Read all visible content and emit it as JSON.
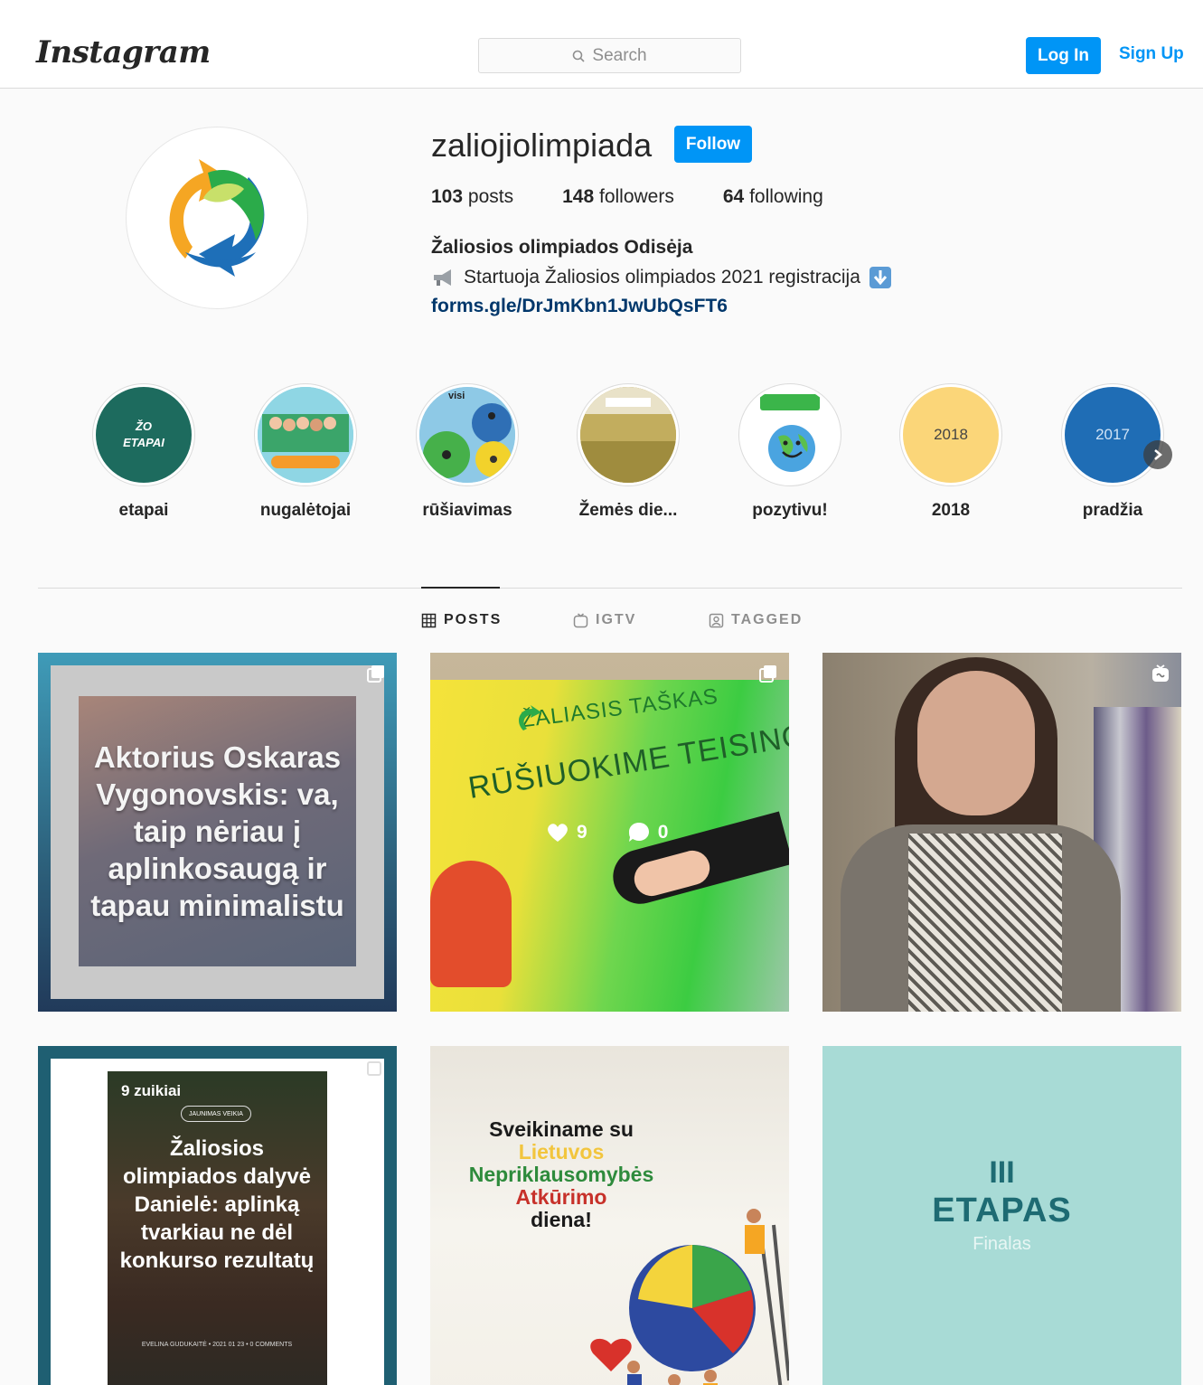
{
  "header": {
    "logo": "Instagram",
    "search_placeholder": "Search",
    "login_label": "Log In",
    "signup_label": "Sign Up"
  },
  "profile": {
    "username": "zaliojiolimpiada",
    "follow_label": "Follow",
    "posts_count": "103",
    "posts_label": "posts",
    "followers_count": "148",
    "followers_label": "followers",
    "following_count": "64",
    "following_label": "following",
    "full_name": "Žaliosios olimpiados Odisėja",
    "bio": "Startuoja Žaliosios olimpiados 2021 registracija",
    "link": "forms.gle/DrJmKbn1JwUbQsFT6"
  },
  "highlights": [
    {
      "label": "etapai",
      "cover_text": "ŽO ETAPAI"
    },
    {
      "label": "nugalėtojai"
    },
    {
      "label": "rūšiavimas",
      "cover_text": "visi"
    },
    {
      "label": "Žemės die..."
    },
    {
      "label": "pozytivu!"
    },
    {
      "label": "2018",
      "cover_text": "2018"
    },
    {
      "label": "pradžia",
      "cover_text": "2017"
    }
  ],
  "tabs": [
    {
      "label": "POSTS",
      "active": true
    },
    {
      "label": "IGTV",
      "active": false
    },
    {
      "label": "TAGGED",
      "active": false
    }
  ],
  "posts": [
    {
      "caption": "Aktorius Oskaras Vygonovskis: va, taip nėriau į aplinkosaugą ir tapau minimalistu"
    },
    {
      "title_top": "ŽALIASIS TAŠKAS",
      "title_main": "RŪŠIUOKIME TEISINGAI!",
      "likes": "9",
      "comments": "0"
    },
    {},
    {
      "header": "9 zuikiai",
      "tag": "JAUNIMAS VEIKIA",
      "caption": "Žaliosios olimpiados dalyvė Danielė: aplinką tvarkiau ne dėl konkurso rezultatų",
      "footer": "EVELINA GUDUKAITĖ • 2021 01 23 • 0 COMMENTS"
    },
    {
      "line1": "Sveikiname su",
      "line2": "Lietuvos",
      "line3": "Nepriklausomybės",
      "line4": "Atkūrimo",
      "line5": "diena!"
    },
    {
      "numeral": "III",
      "title": "ETAPAS",
      "subtitle": "Finalas"
    }
  ],
  "colors": {
    "accent": "#0095f6",
    "link": "#00376b",
    "etapas_bg": "#a8dbd6",
    "etapas_text": "#1e6b73"
  }
}
